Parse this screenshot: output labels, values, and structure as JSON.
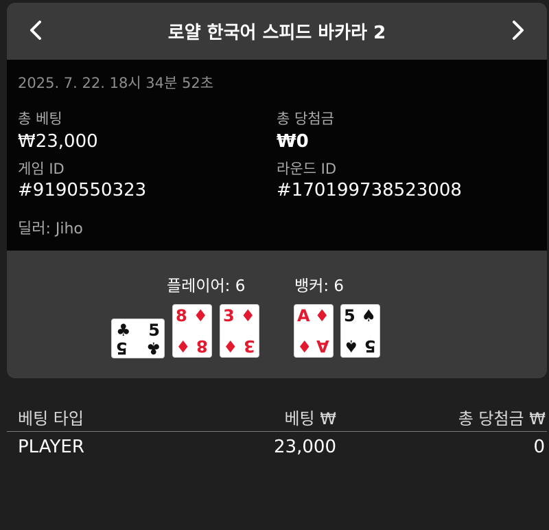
{
  "header": {
    "title": "로얄 한국어 스피드 바카라 2",
    "prev_icon": "chevron-left-icon",
    "next_icon": "chevron-right-icon"
  },
  "info": {
    "timestamp": "2025. 7. 22. 18시 34분 52초",
    "total_bet_label": "총 베팅",
    "total_bet_value": "₩23,000",
    "total_win_label": "총 당첨금",
    "total_win_value": "₩0",
    "game_id_label": "게임 ID",
    "game_id_value": "#9190550323",
    "round_id_label": "라운드 ID",
    "round_id_value": "#170199738523008",
    "dealer": "딜러: Jiho"
  },
  "hands": {
    "player_label": "플레이어: 6",
    "banker_label": "뱅커: 6",
    "player_cards": [
      {
        "rank": "5",
        "suit": "♣",
        "color": "black"
      },
      {
        "rank": "8",
        "suit": "♦",
        "color": "red"
      },
      {
        "rank": "3",
        "suit": "♦",
        "color": "red"
      }
    ],
    "banker_cards": [
      {
        "rank": "A",
        "suit": "♦",
        "color": "red"
      },
      {
        "rank": "5",
        "suit": "♠",
        "color": "black"
      }
    ]
  },
  "bets_table": {
    "headers": [
      "베팅 타입",
      "베팅 ₩",
      "총 당첨금 ₩"
    ],
    "rows": [
      [
        "PLAYER",
        "23,000",
        "0"
      ]
    ]
  },
  "colors": {
    "background": "#1f1f1f",
    "panel": "#3a3a3a",
    "info_bg": "#050505",
    "card_red": "#e3192f"
  }
}
